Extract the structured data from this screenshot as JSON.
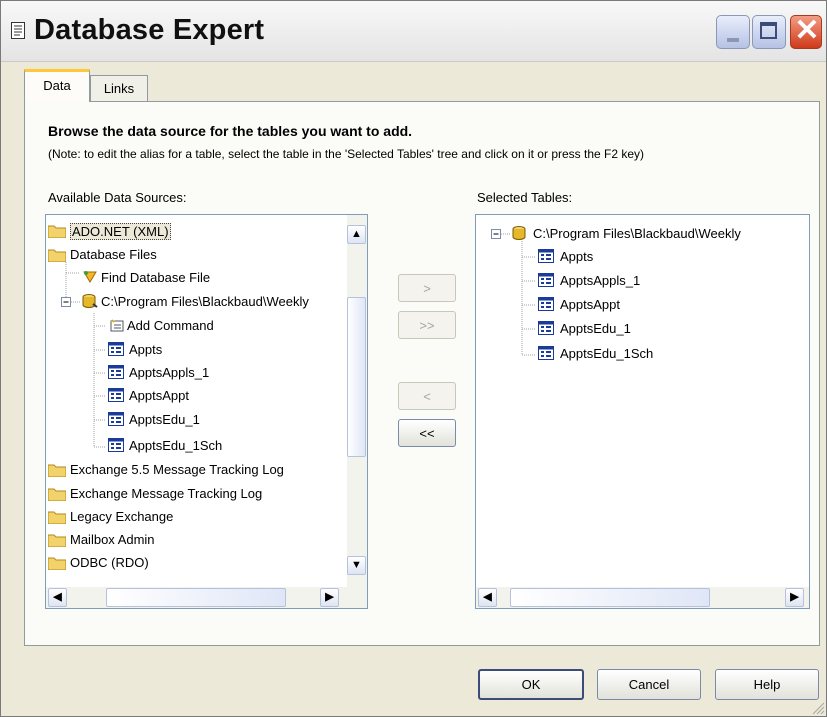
{
  "window": {
    "title": "Database Expert"
  },
  "tabs": [
    {
      "label": "Data",
      "active": true
    },
    {
      "label": "Links",
      "active": false
    }
  ],
  "instructions": {
    "heading": "Browse the data source for the tables you want to add.",
    "note": "(Note: to edit the alias for a table, select the table in the 'Selected Tables' tree and click on it or press the F2 key)"
  },
  "available": {
    "label": "Available Data Sources:",
    "items": [
      {
        "label": "ADO.NET (XML)",
        "icon": "folder-icon",
        "selected": true
      },
      {
        "label": "Database Files",
        "icon": "folder-icon"
      },
      {
        "label": "Find Database File",
        "icon": "find-database-icon"
      },
      {
        "label": "C:\\Program Files\\Blackbaud\\Weekly",
        "icon": "database-connection-icon"
      },
      {
        "label": "Add Command",
        "icon": "add-command-icon"
      },
      {
        "label": "Appts",
        "icon": "table-icon"
      },
      {
        "label": "ApptsAppls_1",
        "icon": "table-icon"
      },
      {
        "label": "ApptsAppt",
        "icon": "table-icon"
      },
      {
        "label": "ApptsEdu_1",
        "icon": "table-icon"
      },
      {
        "label": "ApptsEdu_1Sch",
        "icon": "table-icon"
      },
      {
        "label": "Exchange 5.5 Message Tracking Log",
        "icon": "folder-icon"
      },
      {
        "label": "Exchange Message Tracking Log",
        "icon": "folder-icon"
      },
      {
        "label": "Legacy Exchange",
        "icon": "folder-icon"
      },
      {
        "label": "Mailbox Admin",
        "icon": "folder-icon"
      },
      {
        "label": "ODBC (RDO)",
        "icon": "folder-icon"
      }
    ]
  },
  "selected": {
    "label": "Selected Tables:",
    "items": [
      {
        "label": "C:\\Program Files\\Blackbaud\\Weekly",
        "icon": "database-connection-icon"
      },
      {
        "label": "Appts",
        "icon": "table-icon"
      },
      {
        "label": "ApptsAppls_1",
        "icon": "table-icon"
      },
      {
        "label": "ApptsAppt",
        "icon": "table-icon"
      },
      {
        "label": "ApptsEdu_1",
        "icon": "table-icon"
      },
      {
        "label": "ApptsEdu_1Sch",
        "icon": "table-icon"
      }
    ]
  },
  "transfer_buttons": {
    "add": ">",
    "add_all": ">>",
    "remove": "<",
    "remove_all": "<<"
  },
  "footer": {
    "ok": "OK",
    "cancel": "Cancel",
    "help": "Help"
  }
}
